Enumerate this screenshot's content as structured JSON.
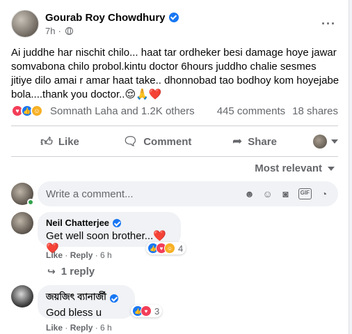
{
  "post": {
    "author": "Gourab Roy Chowdhury",
    "time": "7h",
    "separator": "·",
    "more_icon": "ellipsis-icon",
    "text": "Ai juddhe har nischit chilo...  haat tar ordheker besi damage hoye jawar somvabona chilo probol.kintu doctor 6hours juddho chalie sesmes jitiye dilo amai r amar haat take.. dhonnobad tao bodhoy kom hoyejabe bola....thank you doctor..😌🙏❤️"
  },
  "reactions": {
    "summary": "Somnath Laha and 1.2K others",
    "comments": "445 comments",
    "shares": "18 shares",
    "icons": [
      "heart",
      "like",
      "care"
    ]
  },
  "actions": {
    "like": "Like",
    "comment": "Comment",
    "share": "Share"
  },
  "sort": {
    "label": "Most relevant"
  },
  "composer": {
    "placeholder": "Write a comment..."
  },
  "comments": [
    {
      "author": "Neil Chatterjee",
      "verified": true,
      "text": "Get well soon brother...❤️❤️",
      "reaction_count": "4",
      "like": "Like",
      "reply": "Reply",
      "time": "6 h",
      "replies": "1 reply"
    },
    {
      "author": "জয়জিৎ ব্যানার্জী",
      "verified": true,
      "text": "God bless u",
      "reaction_count": "3",
      "like": "Like",
      "reply": "Reply",
      "time": "6 h"
    }
  ],
  "colors": {
    "accent": "#1877f2",
    "heart": "#f33e58",
    "care": "#f7b125",
    "muted": "#65676b"
  }
}
